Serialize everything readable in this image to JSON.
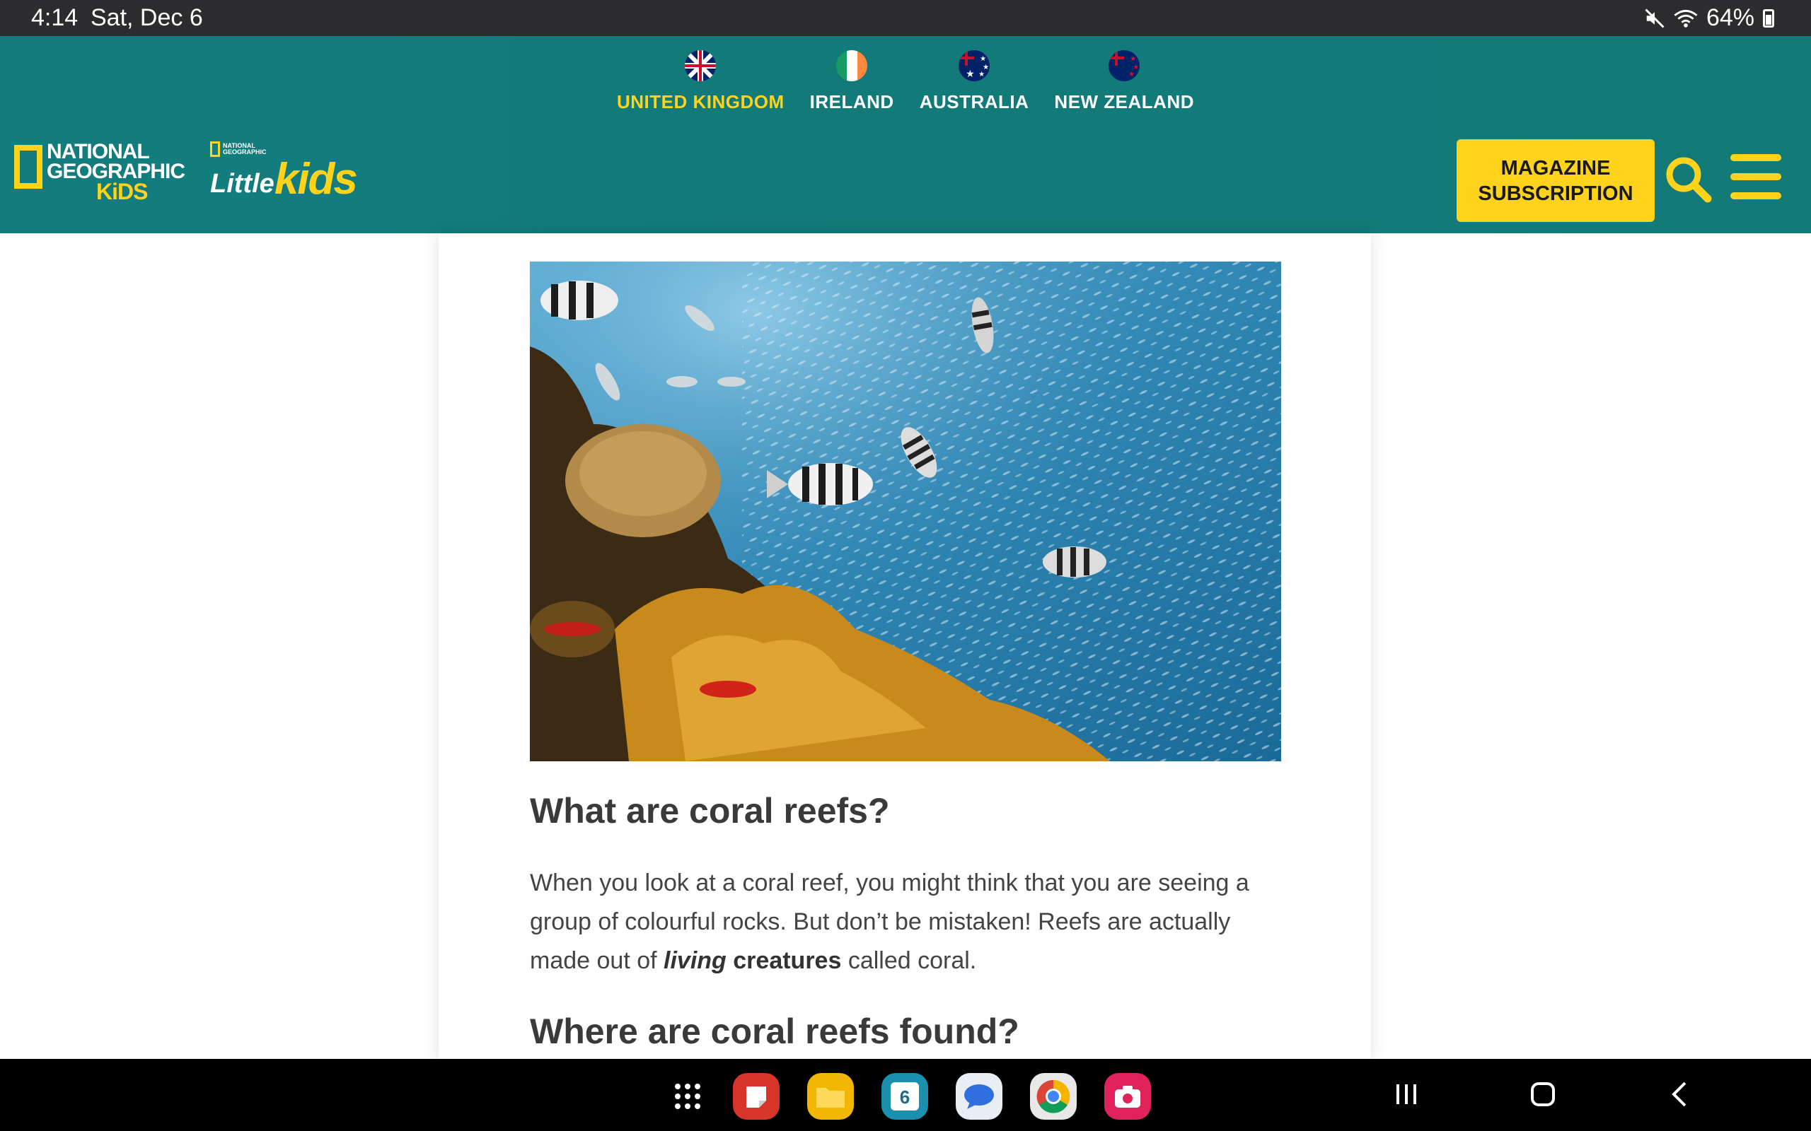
{
  "status_bar": {
    "time": "4:14",
    "date": "Sat, Dec 6",
    "battery": "64%"
  },
  "regions": [
    {
      "label": "UNITED KINGDOM",
      "active": true
    },
    {
      "label": "IRELAND",
      "active": false
    },
    {
      "label": "AUSTRALIA",
      "active": false
    },
    {
      "label": "NEW ZEALAND",
      "active": false
    }
  ],
  "logos": {
    "ngk_line1": "NATIONAL",
    "ngk_line2": "GEOGRAPHIC",
    "ngk_line3": "KiDS",
    "little_small_1": "NATIONAL",
    "little_small_2": "GEOGRAPHIC",
    "little_word": "Little",
    "kids_word": "kids"
  },
  "header": {
    "subscribe_line1": "MAGAZINE",
    "subscribe_line2": "SUBSCRIPTION"
  },
  "article": {
    "heading1": "What are coral reefs?",
    "para_part1": "When you look at a coral reef, you might think that you are seeing a group of colourful rocks. But don’t be mistaken! Reefs are actually made out of ",
    "para_italic": "living",
    "para_bold": "creatures",
    "para_part2": " called coral.",
    "heading2": "Where are coral reefs found?"
  },
  "colors": {
    "header_teal": "#137d7e",
    "accent_yellow": "#ffd21c",
    "active_region": "#ffd21c"
  },
  "taskbar": {
    "apps": [
      "apps-grid-icon",
      "notes-app-icon",
      "files-app-icon",
      "calendar-app-icon",
      "messages-app-icon",
      "chrome-app-icon",
      "camera-app-icon"
    ],
    "calendar_day": "6"
  }
}
